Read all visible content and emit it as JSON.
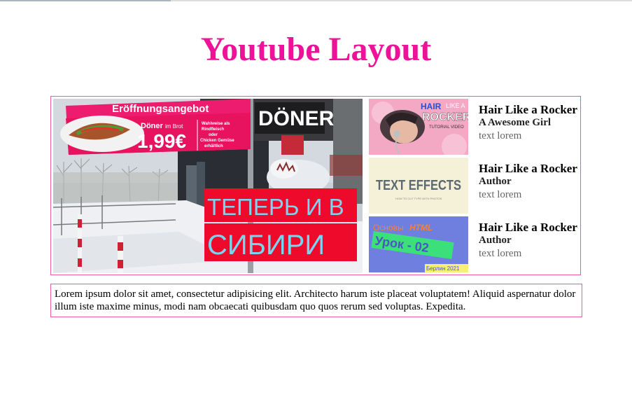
{
  "page": {
    "title": "Youtube Layout",
    "title_color": "#ee1299",
    "border_color": "#ef5aa8",
    "load_progress": 0.27
  },
  "main_video": {
    "banner_headline": "Eröffnungsangebot",
    "banner_product_a": "Döner",
    "banner_product_b": "im Brot",
    "banner_price": "1,99€",
    "banner_note": [
      "Wahlweise als",
      "Rindfleisch",
      "oder",
      "Chicken Gemüse",
      "erhältlich"
    ],
    "shop_sign": "DÖNER",
    "overlay_lines": [
      "ТЕПЕРЬ И В",
      "СИБИРИ"
    ],
    "overlay_text_color": "#7ad4f0",
    "overlay_bg_color": "#ee0a2a"
  },
  "sidebar": {
    "videos": [
      {
        "title": "Hair Like a Rocker",
        "author": "A Awesome Girl",
        "desc": "text lorem",
        "thumb": {
          "line1a": "HAIR",
          "line1b": "LIKE A",
          "line2": "ROCKER",
          "line3": "TUTORIAL VIDEO"
        }
      },
      {
        "title": "Hair Like a Rocker",
        "author": "Author",
        "desc": "text lorem",
        "thumb": {
          "line1": "TEXT EFFECTS",
          "line2": "HOW TO CUT TYPE WITH PHOTOS"
        }
      },
      {
        "title": "Hair Like a Rocker",
        "author": "Author",
        "desc": "text lorem",
        "thumb": {
          "line1a": "Основы",
          "line1b": "HTML",
          "line2": "Урок - 02",
          "line3": "Берлин 2021"
        }
      }
    ]
  },
  "description": {
    "text": "Lorem ipsum dolor sit amet, consectetur adipisicing elit. Architecto harum iste placeat voluptatem! Aliquid aspernatur dolor illum iste maxime minus, modi nam obcaecati quibusdam quo quos rerum sed voluptas. Expedita."
  }
}
